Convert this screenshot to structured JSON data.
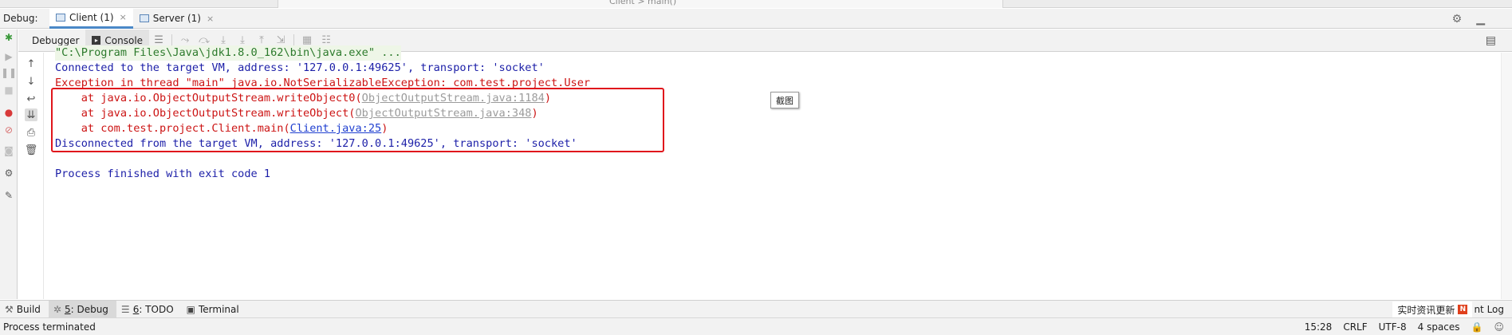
{
  "editor": {
    "breadcrumb": "Client  >  main()"
  },
  "debug_header": {
    "label": "Debug:",
    "tabs": [
      {
        "label": "Client (1)",
        "active": true
      },
      {
        "label": "Server (1)",
        "active": false
      }
    ],
    "close_glyph": "×"
  },
  "sub_tabs": {
    "debugger_label": "Debugger",
    "console_label": "Console"
  },
  "console": {
    "lines": [
      "\"C:\\Program Files\\Java\\jdk1.8.0_162\\bin\\java.exe\" ...",
      "Connected to the target VM, address: '127.0.0.1:49625', transport: 'socket'",
      "Exception in thread \"main\" java.io.NotSerializableException: com.test.project.User",
      "Disconnected from the target VM, address: '127.0.0.1:49625', transport: 'socket'",
      "Process finished with exit code 1"
    ],
    "stack": [
      {
        "prefix": "    at java.io.ObjectOutputStream.writeObject0(",
        "link": "ObjectOutputStream.java:1184",
        "suffix": ")"
      },
      {
        "prefix": "    at java.io.ObjectOutputStream.writeObject(",
        "link": "ObjectOutputStream.java:348",
        "suffix": ")"
      },
      {
        "prefix": "    at com.test.project.Client.main(",
        "link": "Client.java:25",
        "suffix": ")"
      }
    ],
    "tooltip": "截图"
  },
  "bottom_tools": {
    "build": "Build",
    "debug_num": "5",
    "debug_label": ": Debug",
    "todo_num": "6",
    "todo_label": ": TODO",
    "terminal": "Terminal",
    "overlay_text": "实时资讯更新",
    "overlay_badge": "N",
    "event_log": "nt Log"
  },
  "status": {
    "message": "Process terminated",
    "position": "15:28",
    "line_sep": "CRLF",
    "encoding": "UTF-8",
    "indent": "4 spaces"
  },
  "colors": {
    "accent": "#4a88c7",
    "error_red": "#cc1414",
    "info_blue": "#1c1fa8",
    "cmd_green": "#2c7a2c",
    "highlight_box": "#e0161c"
  },
  "icons": {
    "settings": "gear-icon",
    "minimize": "hide-icon",
    "layout": "layout-icon"
  }
}
